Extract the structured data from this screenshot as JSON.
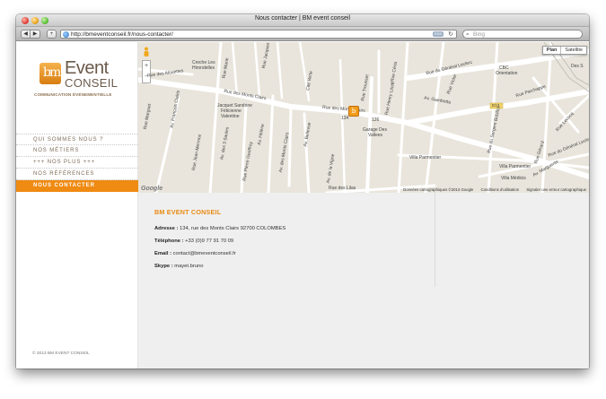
{
  "window": {
    "title": "Nous contacter | BM event conseil"
  },
  "toolbar": {
    "back_icon": "◀",
    "forward_icon": "▶",
    "add_icon": "+",
    "url": "http://bmeventconseil.fr/nous-contacter/",
    "rss_label": "RSS",
    "reload_icon": "↻",
    "search_icon": "🔍",
    "search_placeholder": "Bing"
  },
  "logo": {
    "mark": "bm",
    "word1": "Event",
    "word2": "CONSEIL",
    "tagline": "COMMUNICATION ÉVÉNEMENTIELLE"
  },
  "menu": {
    "items": [
      {
        "label": "QUI SOMMES NOUS ?",
        "active": false
      },
      {
        "label": "NOS MÉTIERS",
        "active": false
      },
      {
        "label": "+++ NOS PLUS +++",
        "active": false
      },
      {
        "label": "NOS RÉFÉRENCES",
        "active": false
      },
      {
        "label": "NOUS CONTACTER",
        "active": true
      }
    ]
  },
  "sidebar": {
    "copyright": "© 2013 BM EVENT CONSEIL"
  },
  "map": {
    "type_plan": "Plan",
    "type_satellite": "Satellite",
    "zoom_in": "+",
    "zoom_out": "−",
    "google": "Google",
    "footer": {
      "data": "Données cartographiques ©2013 Google",
      "terms": "Conditions d'utilisation",
      "report": "Signaler une erreur cartographique"
    },
    "labels": {
      "creche": "Creche Les",
      "hirondelles": "Hirondelles",
      "rue_alouettes": "Rue des Alouettes",
      "rue_marie": "Rue Marie",
      "av_jacques": "Rue Jacques",
      "rue_monts_clairs1": "Rue des Monts Clairs",
      "rue_monts_clairs2": "Rue des Monts Clairs",
      "rue_mariaval": "Rue Marguet",
      "av_francois": "Av. François Clairis",
      "rue_jean_mermoz": "Rue Jean Mermoz",
      "cite_verte": "Cité Verte",
      "jacquet1": "Jacquet Sandrine",
      "jacquet2": "Félicienne",
      "jacquet3": "Valentine",
      "av_saules": "Av. des 3 Saules",
      "rue_geoffroy": "Rue Pierre Geoffroy",
      "av_helene": "Av. Hélène",
      "av_monts_clairs": "Av. des Monts Clairs",
      "av_bellevue": "Av. Bellevue",
      "av_vigne": "Av. de la Vigne",
      "rue_trousset": "Rue Trousset",
      "num_134": "134",
      "num_126": "126",
      "garage1": "Garage Des",
      "garage2": "Vallees",
      "rue_lilas": "Rue des Lilas",
      "rue_henry": "Rue Henry Litolff",
      "rue_general": "Rue du Général Leclerc",
      "cbc": "CBC",
      "orientation": "Orientation",
      "rue_parchappe": "Rue Parchappe",
      "av_gambetta": "Av. Gambetta",
      "d13": "D13",
      "rue_sergent": "Rue du Sergent Bobillot",
      "villa_parmentier": "Villa Parmentier",
      "villa_parmentier2": "Villa Parmentier",
      "villa_medicis": "Villa Médicis",
      "rue_gerard": "Rue Gérard",
      "av_marguerite": "Av. Marguerite",
      "rue_general2": "Rue du Général Leclerc",
      "des_s": "Des S",
      "rue_lecocq": "Rue Lecocq",
      "rue_ceria": "Rue Céria",
      "rue_victor": "Rue Victor"
    }
  },
  "contact": {
    "title": "BM EVENT CONSEIL",
    "address_label": "Adresse :",
    "address_value": " 134, rue des Monts Clairs 92700 COLOMBES",
    "phone_label": "Téléphone :",
    "phone_value": " +33 (0)9 77 91 70 09",
    "email_label": "Email :",
    "email_value": " contact@bmeventconseil.fr",
    "skype_label": "Skype :",
    "skype_value": " mayet.bruno"
  },
  "colors": {
    "accent": "#ef8a12",
    "map_bg": "#e9e5dc",
    "road": "#ffffff",
    "info_bg": "#efefef"
  }
}
